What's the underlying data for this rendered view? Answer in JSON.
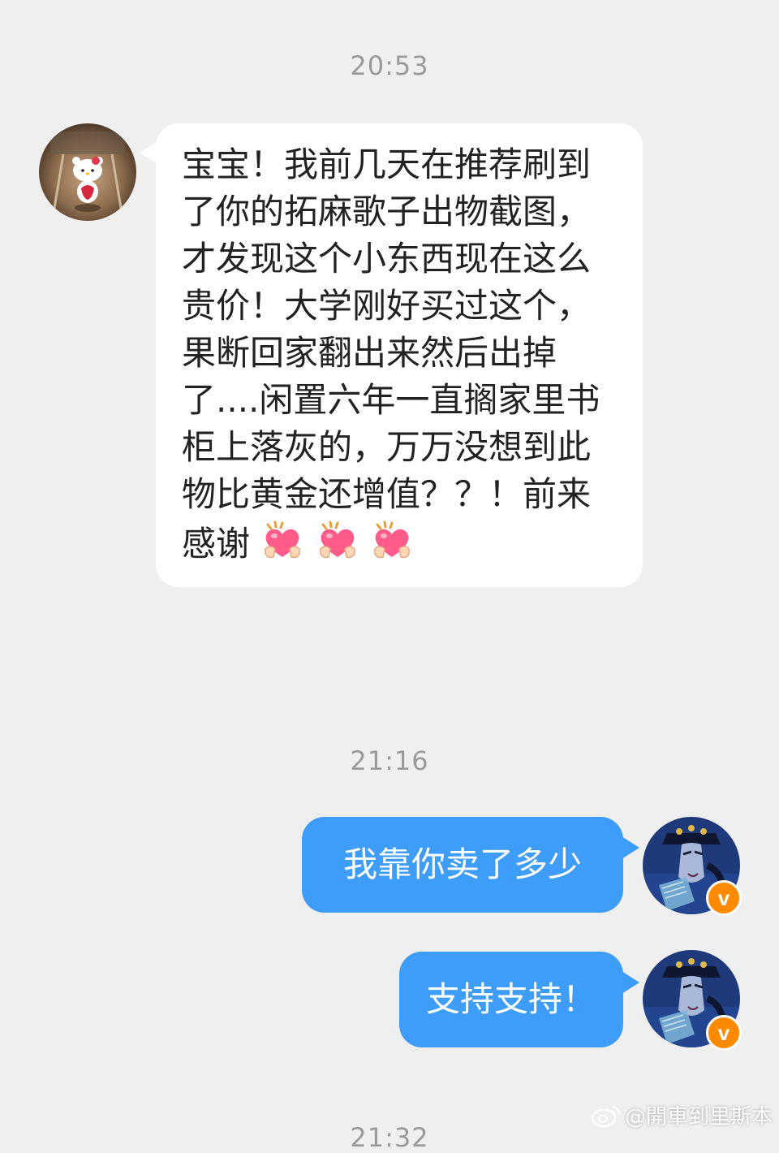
{
  "messages": [
    {
      "time": "20:53",
      "sender": "other",
      "text": "宝宝！我前几天在推荐刷到了你的拓麻歌子出物截图，才发现这个小东西现在这么贵价！大学刚好买过这个，果断回家翻出来然后出掉了....闲置六年一直搁家里书柜上落灰的，万万没想到此物比黄金还增值？？！前来感谢",
      "emoji": [
        "heart-hands",
        "heart-hands",
        "heart-hands"
      ]
    },
    {
      "time": "21:16",
      "sender": "me",
      "text": "我靠你卖了多少"
    },
    {
      "sender": "me",
      "text": "支持支持！"
    }
  ],
  "partial_time": "21:32",
  "watermark": {
    "icon": "weibo-icon",
    "text": "@開車到里斯本"
  },
  "colors": {
    "background": "#efefef",
    "outgoing_bubble": "#3d9df8",
    "incoming_bubble": "#ffffff",
    "timestamp": "#9a9a9a",
    "verified_badge": "#ff8a00"
  },
  "avatars": {
    "other": "hello-kitty-avatar",
    "me": "anime-character-avatar",
    "badge": "verified-v-badge"
  }
}
